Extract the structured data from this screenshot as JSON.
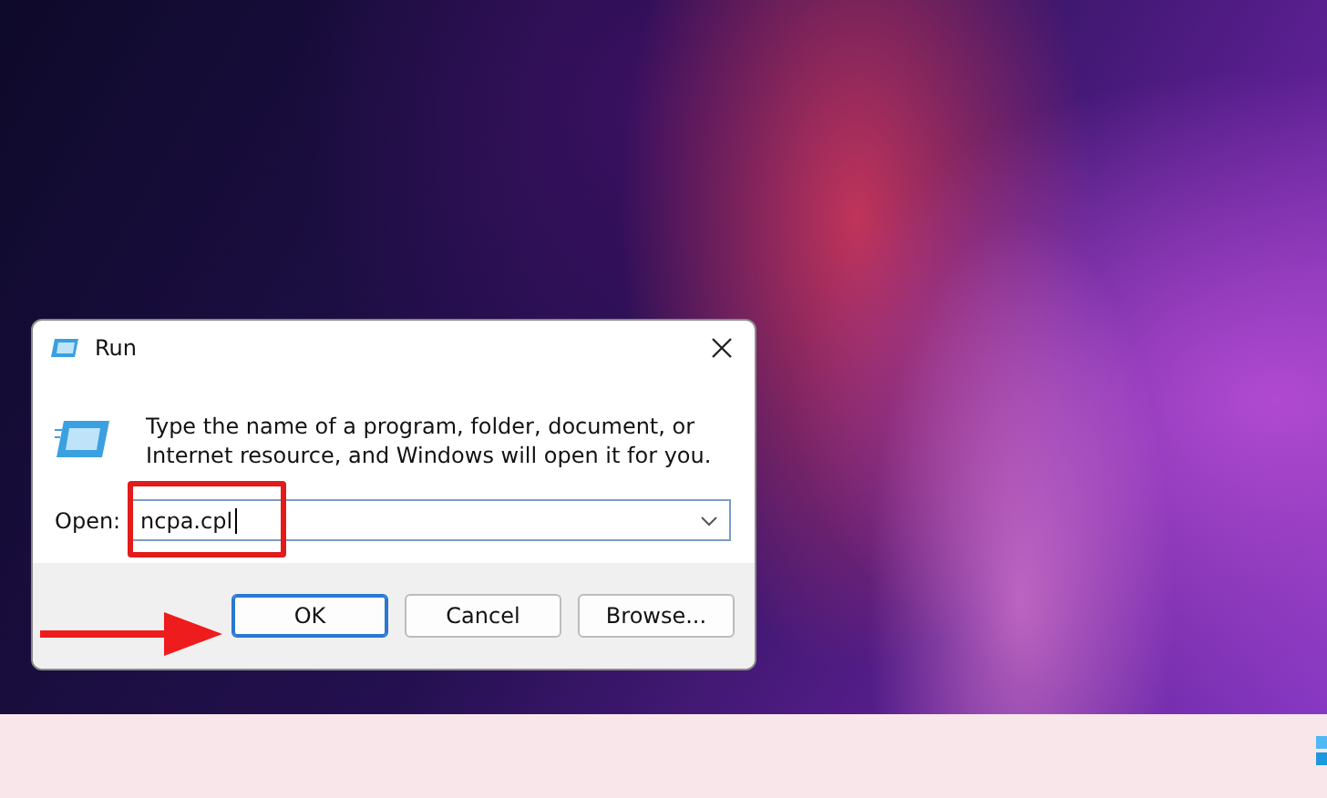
{
  "window": {
    "title": "Run"
  },
  "description": "Type the name of a program, folder, document, or Internet resource, and Windows will open it for you.",
  "open_field": {
    "label": "Open:",
    "value": "ncpa.cpl"
  },
  "buttons": [
    {
      "label": "OK",
      "selected": true
    },
    {
      "label": "Cancel",
      "selected": false
    },
    {
      "label": "Browse...",
      "selected": false
    }
  ]
}
